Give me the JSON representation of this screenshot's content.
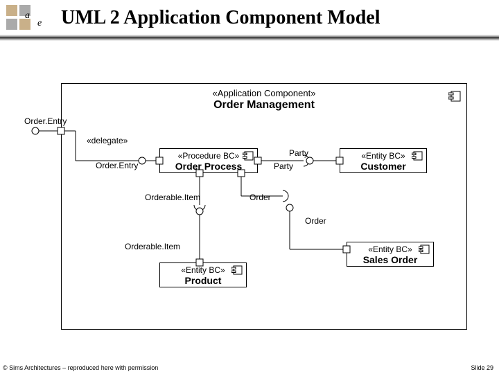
{
  "title": "UML 2 Application Component Model",
  "footer_left": "© Sims Architectures – reproduced here with permission",
  "footer_right": "Slide 29",
  "outer": {
    "stereotype": "«Application Component»",
    "name": "Order Management"
  },
  "components": {
    "order_process": {
      "stereotype": "«Procedure BC»",
      "name": "Order Process"
    },
    "customer": {
      "stereotype": "«Entity BC»",
      "name": "Customer"
    },
    "sales_order": {
      "stereotype": "«Entity BC»",
      "name": "Sales Order"
    },
    "product": {
      "stereotype": "«Entity BC»",
      "name": "Product"
    }
  },
  "labels": {
    "port_outer": "Order.Entry",
    "delegate": "«delegate»",
    "left_iface": "Order.Entry",
    "party_top": "Party",
    "party_port": "Party",
    "orderable_item_top": "Orderable.Item",
    "order_right": "Order",
    "order_below": "Order",
    "orderable_item_bottom": "Orderable.Item"
  }
}
